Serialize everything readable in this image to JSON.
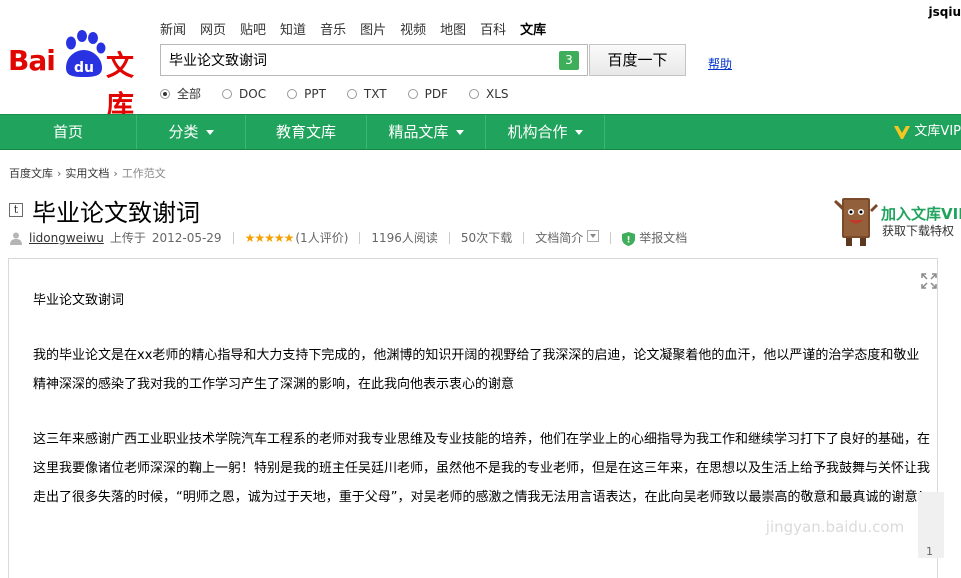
{
  "header": {
    "user": "jsqiu",
    "nav": [
      "新闻",
      "网页",
      "贴吧",
      "知道",
      "音乐",
      "图片",
      "视频",
      "地图",
      "百科",
      "文库"
    ],
    "nav_active_index": 9,
    "logo": {
      "bai": "Bai",
      "du": "du",
      "wenku": "文库"
    },
    "search": {
      "value": "毕业论文致谢词",
      "badge": "3",
      "button": "百度一下"
    },
    "help": "帮助",
    "filters": [
      {
        "label": "全部",
        "checked": true
      },
      {
        "label": "DOC",
        "checked": false
      },
      {
        "label": "PPT",
        "checked": false
      },
      {
        "label": "TXT",
        "checked": false
      },
      {
        "label": "PDF",
        "checked": false
      },
      {
        "label": "XLS",
        "checked": false
      }
    ]
  },
  "mainnav": {
    "items": [
      {
        "label": "首页",
        "dropdown": false
      },
      {
        "label": "分类",
        "dropdown": true
      },
      {
        "label": "教育文库",
        "dropdown": false
      },
      {
        "label": "精品文库",
        "dropdown": true
      },
      {
        "label": "机构合作",
        "dropdown": true
      }
    ],
    "vip": "文库VIP"
  },
  "breadcrumb": [
    "百度文库",
    "实用文档",
    "工作范文"
  ],
  "doc": {
    "type_icon": "t",
    "title": "毕业论文致谢词",
    "author": "lidongweiwu",
    "uploaded": "上传于",
    "date": "2012-05-29",
    "stars": "★★★★★",
    "ratings": "(1人评价)",
    "reads": "1196人阅读",
    "downloads": "50次下载",
    "summary": "文档简介",
    "report": "举报文档"
  },
  "promo": {
    "title": "加入文库VIP",
    "subtitle": "获取下载特权"
  },
  "content": {
    "paragraphs": [
      "毕业论文致谢词",
      "我的毕业论文是在xx老师的精心指导和大力支持下完成的，他渊博的知识开阔的视野给了我深深的启迪，论文凝聚着他的血汗，他以严谨的治学态度和敬业精神深深的感染了我对我的工作学习产生了深渊的影响，在此我向他表示衷心的谢意",
      "这三年来感谢广西工业职业技术学院汽车工程系的老师对我专业思维及专业技能的培养，他们在学业上的心细指导为我工作和继续学习打下了良好的基础，在这里我要像诸位老师深深的鞠上一躬！特别是我的班主任吴廷川老师，虽然他不是我的专业老师，但是在这三年来，在思想以及生活上给予我鼓舞与关怀让我走出了很多失落的时候，“明师之恩，诚为过于天地，重于父母”，对吴老师的感激之情我无法用言语表达，在此向吴老师致以最崇高的敬意和最真诚的谢意！"
    ],
    "page_number": "1"
  },
  "colors": {
    "brand_red": "#e10602",
    "nav_green": "#20a35c",
    "star": "#f5a000"
  },
  "watermark": "jingyan.baidu.com"
}
